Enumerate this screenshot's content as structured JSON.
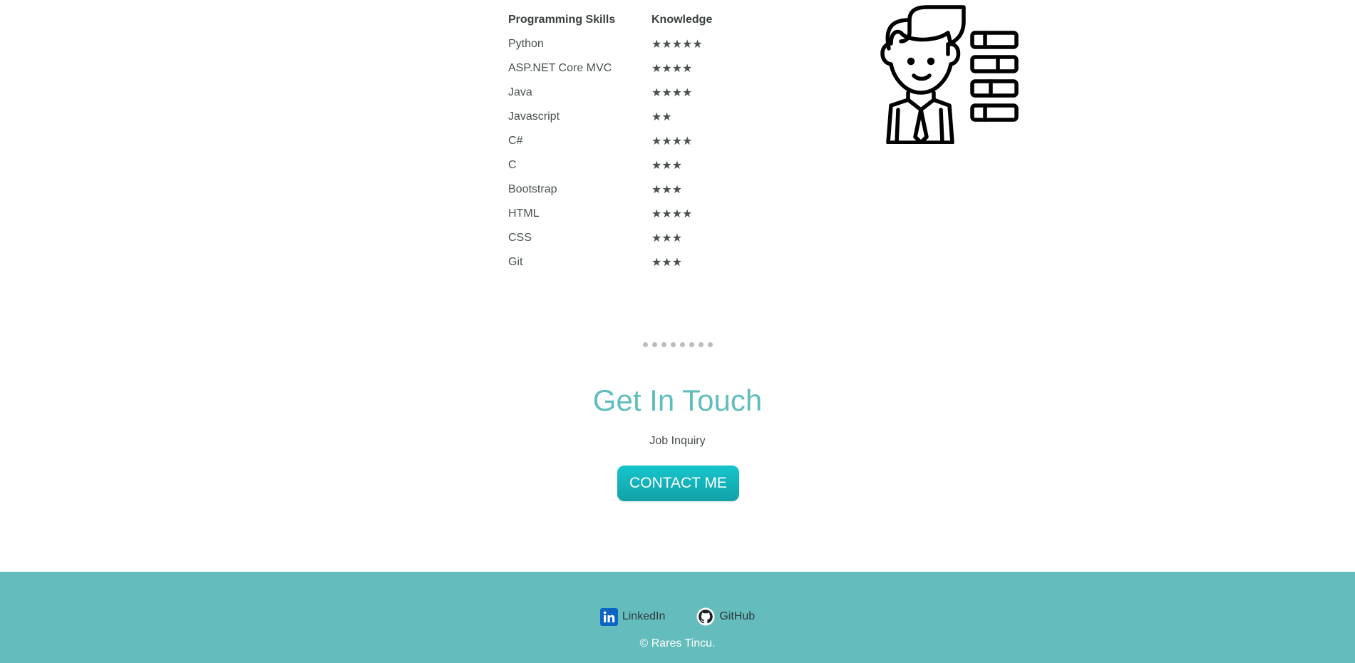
{
  "skills": {
    "headers": [
      "Programming Skills",
      "Knowledge"
    ],
    "rows": [
      {
        "name": "Python",
        "stars": "★★★★★",
        "rating": 5
      },
      {
        "name": "ASP.NET Core MVC",
        "stars": "★★★★",
        "rating": 4
      },
      {
        "name": "Java",
        "stars": "★★★★",
        "rating": 4
      },
      {
        "name": "Javascript",
        "stars": "★★",
        "rating": 2
      },
      {
        "name": "C#",
        "stars": "★★★★",
        "rating": 4
      },
      {
        "name": "C",
        "stars": "★★★",
        "rating": 3
      },
      {
        "name": "Bootstrap",
        "stars": "★★★",
        "rating": 3
      },
      {
        "name": "HTML",
        "stars": "★★★★",
        "rating": 4
      },
      {
        "name": "CSS",
        "stars": "★★★",
        "rating": 3
      },
      {
        "name": "Git",
        "stars": "★★★",
        "rating": 3
      }
    ]
  },
  "illustration": {
    "icon": "developer-with-server-icon"
  },
  "divider": {
    "dots": 8
  },
  "contact": {
    "title": "Get In Touch",
    "subtitle": "Job Inquiry",
    "button_label": "CONTACT ME"
  },
  "footer": {
    "links": [
      {
        "label": "LinkedIn",
        "icon": "linkedin-icon"
      },
      {
        "label": "GitHub",
        "icon": "github-icon"
      }
    ],
    "copyright": "© Rares Tincu."
  },
  "colors": {
    "accent": "#62bdbd",
    "footer_bg": "#64bdbc",
    "button": "#14b3ba",
    "linkedin": "#0a66c2"
  }
}
